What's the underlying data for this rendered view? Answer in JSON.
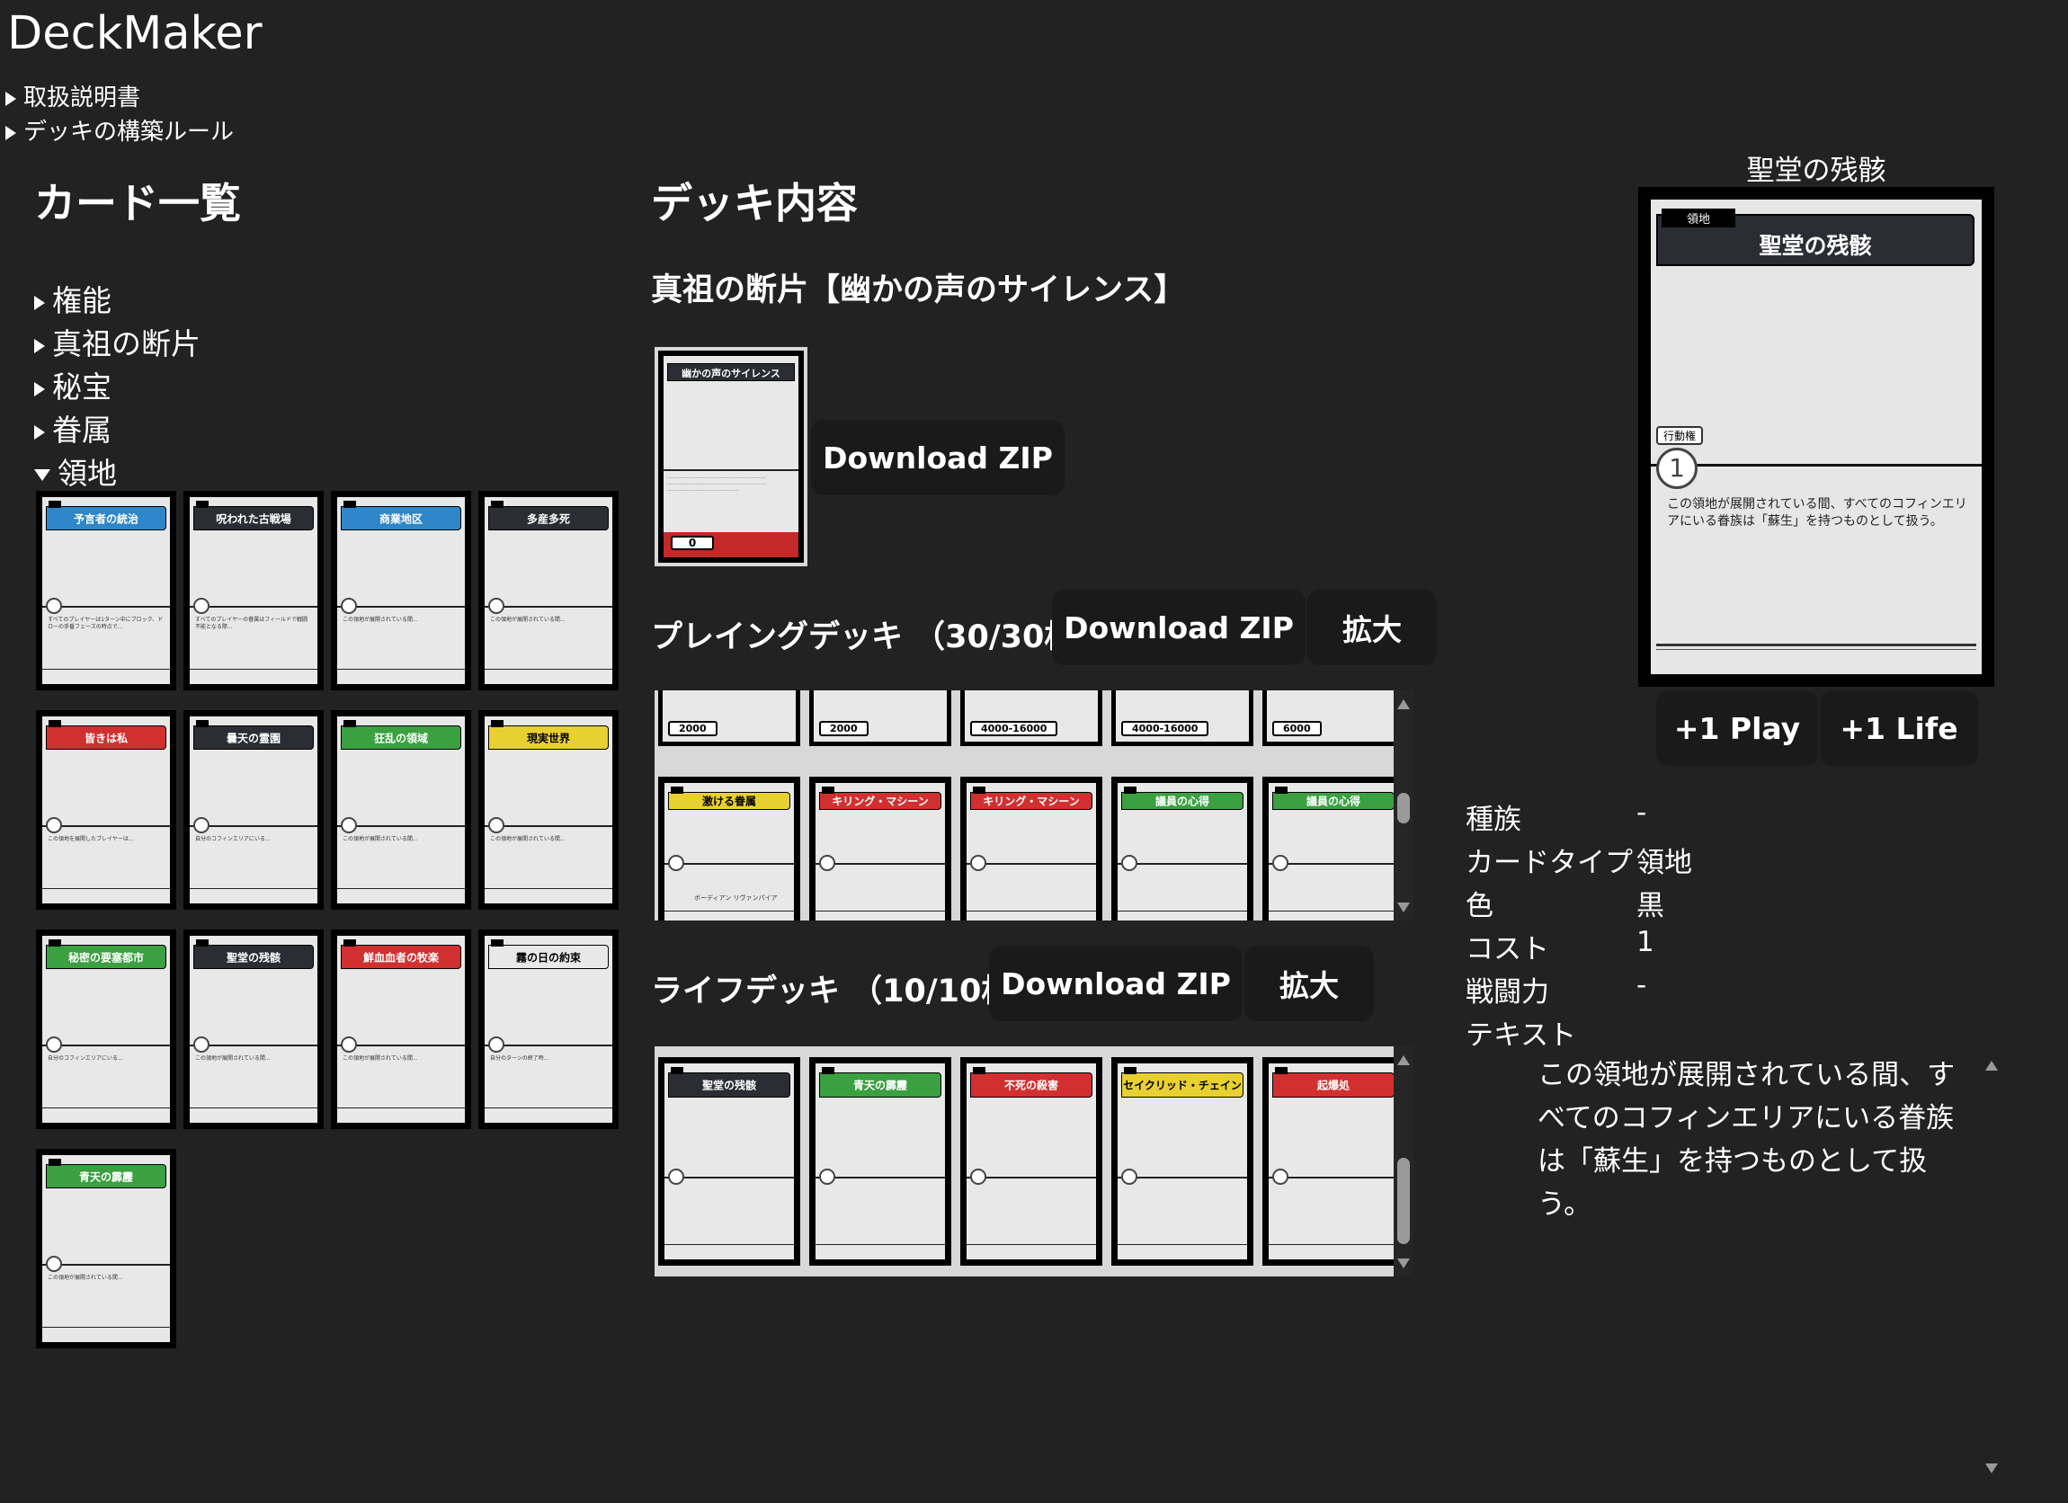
{
  "app": {
    "title": "DeckMaker"
  },
  "rules": [
    {
      "label": "取扱説明書"
    },
    {
      "label": "デッキの構築ルール"
    }
  ],
  "card_list": {
    "heading": "カード一覧",
    "categories": [
      {
        "label": "権能",
        "expanded": false
      },
      {
        "label": "真祖の断片",
        "expanded": false
      },
      {
        "label": "秘宝",
        "expanded": false
      },
      {
        "label": "眷属",
        "expanded": false
      },
      {
        "label": "領地",
        "expanded": true
      }
    ],
    "territory_cards": [
      {
        "name": "予言者の統治",
        "color": "#2f86c8",
        "text": "すべてのプレイヤーは1ターン中にブロック、ドローの手番フェーズの時点で..."
      },
      {
        "name": "呪われた古戦場",
        "color": "#2a2d33",
        "text": "すべてのプレイヤーの眷属はフィールドで戦闘不能となる際..."
      },
      {
        "name": "商業地区",
        "color": "#2f86c8",
        "text": "この領地が展開されている間..."
      },
      {
        "name": "多産多死",
        "color": "#2a2d33",
        "text": "この領地が展開されている間..."
      },
      {
        "name": "皆きは私",
        "color": "#d23030",
        "text": "この領地を展開したプレイヤーは..."
      },
      {
        "name": "曇天の霊園",
        "color": "#2a2d33",
        "text": "自分のコフィンエリアにいる..."
      },
      {
        "name": "狂乱の領域",
        "color": "#3aa040",
        "text": "この領地が展開されている間..."
      },
      {
        "name": "現実世界",
        "color": "#e8d030",
        "text": "この領地が展開されている間..."
      },
      {
        "name": "秘密の要塞都市",
        "color": "#3aa040",
        "text": "自分のコフィンエリアにいる..."
      },
      {
        "name": "聖堂の残骸",
        "color": "#2a2d33",
        "text": "この領地が展開されている間..."
      },
      {
        "name": "鮮血血者の牧楽",
        "color": "#d23030",
        "text": "この領地が展開されている間..."
      },
      {
        "name": "霧の日の約束",
        "color": "#e8e8e8",
        "text": "自分のターンの終了時..."
      },
      {
        "name": "青天の霹靂",
        "color": "#3aa040",
        "text": "この領地が展開されている間..."
      }
    ]
  },
  "deck": {
    "heading": "デッキ内容",
    "fragment": {
      "label": "真祖の断片【幽かの声のサイレンス】",
      "card_name": "幽かの声のサイレンス",
      "card_cost": "0",
      "download_label": "Download ZIP"
    },
    "playing": {
      "label": "プレイングデッキ （30/30枚）",
      "download_label": "Download ZIP",
      "zoom_label": "拡大",
      "row1_values": [
        "2000",
        "2000",
        "4000-16000",
        "4000-16000",
        "6000"
      ],
      "row2_cards": [
        {
          "name": "激ける眷属",
          "color": "#e8d030"
        },
        {
          "name": "キリング・マシーン",
          "color": "#d23030"
        },
        {
          "name": "キリング・マシーン",
          "color": "#d23030"
        },
        {
          "name": "議員の心得",
          "color": "#3aa040"
        },
        {
          "name": "議員の心得",
          "color": "#3aa040"
        }
      ],
      "row2_note": "ボーディアン リヴァンパイア"
    },
    "life": {
      "label": "ライフデッキ （10/10枚）",
      "download_label": "Download ZIP",
      "zoom_label": "拡大",
      "cards": [
        {
          "name": "聖堂の残骸",
          "color": "#2a2d33"
        },
        {
          "name": "青天の霹靂",
          "color": "#3aa040"
        },
        {
          "name": "不死の殺害",
          "color": "#d23030"
        },
        {
          "name": "セイクリッド・チェイン",
          "color": "#e8d030"
        },
        {
          "name": "起爆処",
          "color": "#d23030"
        }
      ]
    }
  },
  "preview": {
    "title": "聖堂の残骸",
    "type_tag": "領地",
    "card_name": "聖堂の残骸",
    "action_label": "行動権",
    "action_value": "1",
    "card_text": "この領地が展開されている間、すべてのコフィンエリアにいる眷族は「蘇生」を持つものとして扱う。",
    "play_button": "+1 Play",
    "life_button": "+1 Life"
  },
  "details": {
    "rows": [
      {
        "label": "種族",
        "value": "-"
      },
      {
        "label": "カードタイプ",
        "value": "領地"
      },
      {
        "label": "色",
        "value": "黒"
      },
      {
        "label": "コスト",
        "value": "1"
      },
      {
        "label": "戦闘力",
        "value": "-"
      },
      {
        "label": "テキスト",
        "value": ""
      }
    ],
    "text": "この領地が展開されている間、すべてのコフィンエリアにいる眷族は「蘇生」を持つものとして扱う。"
  }
}
